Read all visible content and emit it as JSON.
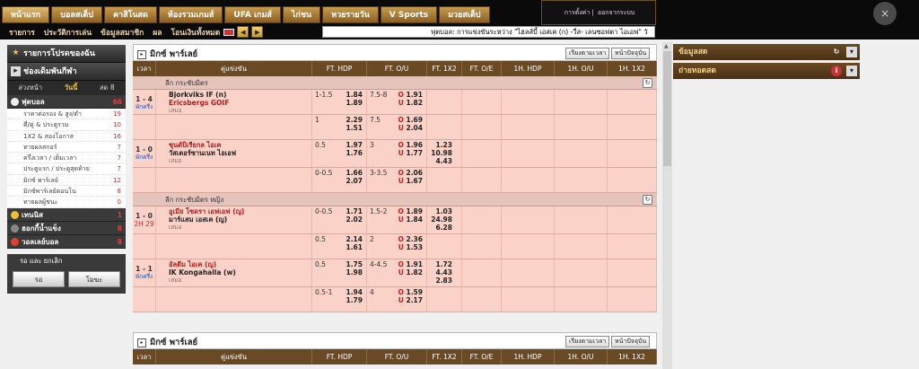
{
  "nav": {
    "tabs": [
      "หน้าแรก",
      "บอลสเต็ป",
      "คาสิโนสด",
      "ห้องรวมเกมส์",
      "UFA เกมส์",
      "ไก่ชน",
      "หวยรายวัน",
      "V Sports",
      "มวยสเต็ป"
    ],
    "active_index": 0
  },
  "user": {
    "links": [
      "การตั้งค่า",
      "ออกจากระบบ"
    ]
  },
  "close_icon": "×",
  "subnav": {
    "items": [
      "รายการ",
      "ประวัติการเล่น",
      "ข้อมูลสมาชิก",
      "ผล",
      "โอนเงินทั้งหมด"
    ]
  },
  "ticker": {
    "text": "ฟุตบอล: การแข่งขันระหว่าง \"ไฮลส์บี้ เอสเค (ก) -วี่ส- เลนซอฟตา ไอเอฟ\" วั"
  },
  "left": {
    "favorites": "รายการโปรดของฉัน",
    "sports_title": "ช่องเดิมพันกีฬา",
    "filters": [
      "ล่วงหน้า",
      "วันนี้",
      "สด"
    ],
    "live_count": "8",
    "football": {
      "label": "ฟุตบอล",
      "count": "66"
    },
    "sub_items": [
      {
        "label": "ราคาต่อรอง & สูง/ต่ำ",
        "count": "19"
      },
      {
        "label": "คี่/คู่ & ประตูรวม",
        "count": "10"
      },
      {
        "label": "1X2 & สองโอกาส",
        "count": "16"
      },
      {
        "label": "ทายผลสกอร์",
        "count": "7"
      },
      {
        "label": "ครึ่งเวลา / เต็มเวลา",
        "count": "7"
      },
      {
        "label": "ประตูแรก / ประตูสุดท้าย",
        "count": "7"
      },
      {
        "label": "มิกซ์ พาร์เลย์",
        "count": "12"
      },
      {
        "label": "มิกซ์พาร์เลย์ตอนโน",
        "count": "8"
      },
      {
        "label": "ทายผลผู้ชนะ",
        "count": "0"
      }
    ],
    "other_sports": [
      {
        "label": "เทนนิส",
        "count": "1"
      },
      {
        "label": "ฮอกกี้น้ำแข็ง",
        "count": "8"
      },
      {
        "label": "วอลเลย์บอล",
        "count": "8"
      }
    ],
    "search_title": "รอ และ ยกเลิก",
    "search_buttons": [
      "รอ",
      "โมฆะ"
    ]
  },
  "main": {
    "panel_title": "มิกซ์ พาร์เลย์",
    "btn_sort": "เรียงตามเวลา",
    "btn_today": "หน้าปัจจุบัน",
    "headers": [
      "เวลา",
      "คู่แข่งขัน",
      "FT. HDP",
      "FT. O/U",
      "FT. 1X2",
      "FT. O/E",
      "1H. HDP",
      "1H. O/U",
      "1H. 1X2"
    ],
    "leagues": [
      {
        "name": "ลีก กระชับมิตร",
        "matches": [
          {
            "score": "1 - 4",
            "time": "พักครึ่ง",
            "home": "Bjorkviks IF (n)",
            "away": "Ericsbergs GOIF",
            "draw": "เสมอ",
            "rows": [
              {
                "hdp": "1-1.5",
                "hdp_odds": [
                  "1.84",
                  "1.89"
                ],
                "ou_line": "7.5-8",
                "ou": [
                  "1.91",
                  "1.82"
                ],
                "x12": []
              },
              {
                "hdp": "1",
                "hdp_odds": [
                  "2.29",
                  "1.51"
                ],
                "ou_line": "7.5",
                "ou": [
                  "1.69",
                  "2.04"
                ],
                "x12": []
              }
            ]
          },
          {
            "score": "1 - 0",
            "time": "พักครึ่ง",
            "home": "ชุนดับิเรียกล ไอเค",
            "away": "วัสเตอร์ซานเนท ไอเอฟ",
            "draw": "เสมอ",
            "rows": [
              {
                "hdp": "0.5",
                "hdp_odds": [
                  "1.97",
                  "1.76"
                ],
                "ou_line": "3",
                "ou": [
                  "1.96",
                  "1.77"
                ],
                "x12": [
                  "1.23",
                  "10.98",
                  "4.43"
                ]
              },
              {
                "hdp": "0-0.5",
                "hdp_odds": [
                  "1.66",
                  "2.07"
                ],
                "ou_line": "3-3.5",
                "ou": [
                  "2.06",
                  "1.67"
                ],
                "x12": []
              }
            ]
          }
        ]
      },
      {
        "name": "ลีก กระชับมิตร หญิง",
        "matches": [
          {
            "score": "1 - 0",
            "time": "2H 29",
            "home": "อูเมีย โซดรา เอฟเอฟ (ญ)",
            "away": "มาร์แสม เอสเค (ญ)",
            "draw": "เสมอ",
            "rows": [
              {
                "hdp": "0-0.5",
                "hdp_odds": [
                  "1.71",
                  "2.02"
                ],
                "ou_line": "1.5-2",
                "ou": [
                  "1.89",
                  "1.84"
                ],
                "x12": [
                  "1.03",
                  "24.98",
                  "6.28"
                ]
              },
              {
                "hdp": "0.5",
                "hdp_odds": [
                  "2.14",
                  "1.61"
                ],
                "ou_line": "2",
                "ou": [
                  "2.36",
                  "1.53"
                ],
                "x12": []
              }
            ]
          },
          {
            "score": "1 - 1",
            "time": "พักครึ่ง",
            "home": "อัลดีม ไอเค (ญ)",
            "away": "IK Kongahalla (w)",
            "draw": "เสมอ",
            "rows": [
              {
                "hdp": "0.5",
                "hdp_odds": [
                  "1.75",
                  "1.98"
                ],
                "ou_line": "4-4.5",
                "ou": [
                  "1.91",
                  "1.82"
                ],
                "x12": [
                  "1.72",
                  "4.43",
                  "2.83"
                ]
              },
              {
                "hdp": "0.5-1",
                "hdp_odds": [
                  "1.94",
                  "1.79"
                ],
                "ou_line": "4",
                "ou": [
                  "1.59",
                  "2.17"
                ],
                "x12": []
              }
            ]
          }
        ]
      }
    ]
  },
  "right": {
    "items": [
      "ข้อมูลสด",
      "ถ่ายทอดสด"
    ]
  },
  "ou_tags": [
    "O",
    "U"
  ]
}
